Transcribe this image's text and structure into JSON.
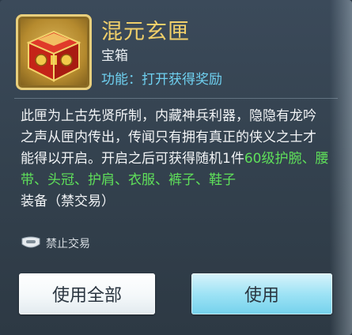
{
  "item": {
    "name": "混元玄匣",
    "type": "宝箱",
    "function": "功能：打开获得奖励"
  },
  "description": {
    "segments": [
      {
        "text": "此匣为上古先贤所制，内藏神兵利器，隐隐有龙吟之声从匣内传出，传闻只有拥有真正的侠义之士才能得以开启。开启之后可获得随机",
        "highlight": false
      },
      {
        "text": "1",
        "highlight": false
      },
      {
        "text": "件",
        "highlight": false
      },
      {
        "text": "60级护腕、腰带、头冠、护肩、衣服、裤子、鞋子",
        "highlight": true
      },
      {
        "text": "装备（禁交易）",
        "highlight": false
      }
    ]
  },
  "trade_status": {
    "label": "禁止交易",
    "icon": "lock-trade-icon"
  },
  "buttons": {
    "use_all": "使用全部",
    "use": "使用"
  },
  "colors": {
    "title": "#f0cf6a",
    "function_text": "#6fd0f0",
    "highlight": "#5fe05a"
  }
}
